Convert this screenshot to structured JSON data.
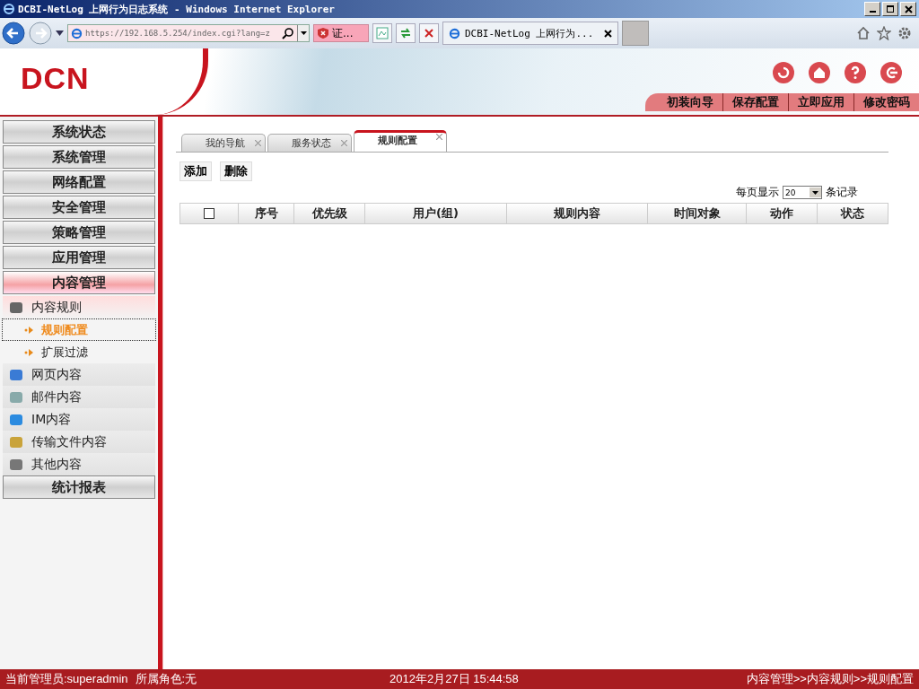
{
  "window": {
    "title": "DCBI-NetLog 上网行为日志系统 - Windows Internet Explorer"
  },
  "browser": {
    "address": "https://192.168.5.254/index.cgi?lang=z",
    "cert_label": "证...",
    "tab_title": "DCBI-NetLog 上网行为..."
  },
  "header": {
    "logo": "DCN",
    "actions": [
      "初装向导",
      "保存配置",
      "立即应用",
      "修改密码"
    ]
  },
  "sidebar": {
    "groups": [
      {
        "label": "系统状态",
        "expanded": false
      },
      {
        "label": "系统管理",
        "expanded": false
      },
      {
        "label": "网络配置",
        "expanded": false
      },
      {
        "label": "安全管理",
        "expanded": false
      },
      {
        "label": "策略管理",
        "expanded": false
      },
      {
        "label": "应用管理",
        "expanded": false
      },
      {
        "label": "内容管理",
        "expanded": true,
        "children": [
          {
            "label": "内容规则",
            "expanded": true,
            "children": [
              {
                "label": "规则配置",
                "selected": true
              },
              {
                "label": "扩展过滤",
                "selected": false
              }
            ]
          },
          {
            "label": "网页内容",
            "expanded": false
          },
          {
            "label": "邮件内容",
            "expanded": false
          },
          {
            "label": "IM内容",
            "expanded": false
          },
          {
            "label": "传输文件内容",
            "expanded": false
          },
          {
            "label": "其他内容",
            "expanded": false
          }
        ]
      },
      {
        "label": "统计报表",
        "expanded": false
      }
    ]
  },
  "tabs": [
    {
      "label": "我的导航",
      "selected": false
    },
    {
      "label": "服务状态",
      "selected": false
    },
    {
      "label": "规则配置",
      "selected": true
    }
  ],
  "toolbar": {
    "buttons": [
      "添加",
      "删除"
    ]
  },
  "page_size": {
    "label": "每页显示",
    "value": "20",
    "unit": "条记录"
  },
  "table": {
    "select_all_checked": false,
    "columns": [
      "序号",
      "优先级",
      "用户(组)",
      "规则内容",
      "时间对象",
      "动作",
      "状态"
    ]
  },
  "status_bar": {
    "admin": "当前管理员:superadmin",
    "role": "所属角色:无",
    "datetime": "2012年2月27日 15:44:58",
    "breadcrumb": "内容管理>>内容规则>>规则配置"
  }
}
